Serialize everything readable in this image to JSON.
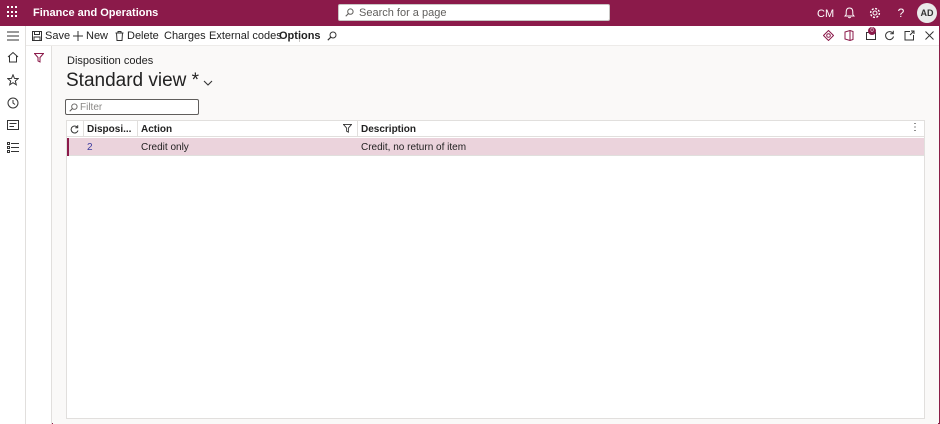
{
  "header": {
    "app_title": "Finance and Operations",
    "search_placeholder": "Search for a page",
    "company": "CM",
    "avatar_initials": "AD"
  },
  "actions": {
    "save": "Save",
    "new": "New",
    "delete": "Delete",
    "charges": "Charges",
    "external_codes": "External codes",
    "options": "Options",
    "notification_count": "0"
  },
  "page": {
    "caption": "Disposition codes",
    "view_name": "Standard view *",
    "filter_placeholder": "Filter"
  },
  "grid": {
    "columns": [
      "Disposi...",
      "Action",
      "Description"
    ],
    "rows": [
      {
        "disposition": "2",
        "action": "Credit only",
        "description": "Credit, no return of item"
      }
    ]
  },
  "colors": {
    "brand": "#8b1a4a",
    "selected_row": "#ebd3dc"
  }
}
